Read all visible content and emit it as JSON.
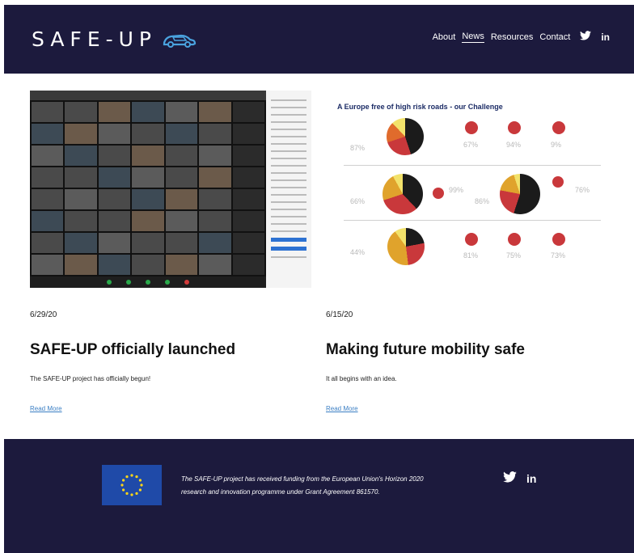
{
  "header": {
    "logo_text": "SAFE-UP",
    "nav": [
      {
        "label": "About",
        "active": false
      },
      {
        "label": "News",
        "active": true
      },
      {
        "label": "Resources",
        "active": false
      },
      {
        "label": "Contact",
        "active": false
      }
    ],
    "social_icons": [
      "twitter-icon",
      "linkedin-icon"
    ],
    "linkedin_text": "in"
  },
  "posts": [
    {
      "date": "6/29/20",
      "title": "SAFE-UP officially launched",
      "excerpt": "The SAFE-UP project has officially begun!",
      "read_more": "Read More",
      "image_type": "video-call-screenshot"
    },
    {
      "date": "6/15/20",
      "title": "Making future mobility safe",
      "excerpt": "It all begins with an idea.",
      "read_more": "Read More",
      "image_type": "infographic",
      "image_title": "A Europe free of high risk roads - our Challenge"
    }
  ],
  "footer": {
    "funding_text": "The SAFE-UP project has received funding from the European Union's Horizon 2020 research and innovation programme under Grant Agreement 861570.",
    "social_icons": [
      "twitter-icon",
      "linkedin-icon"
    ],
    "linkedin_text": "in"
  },
  "colors": {
    "header_bg": "#1c1a3d",
    "footer_bg": "#1c1a3d",
    "link": "#3b7fc4",
    "eu_blue": "#1f4aa8",
    "eu_star": "#ffd617"
  }
}
